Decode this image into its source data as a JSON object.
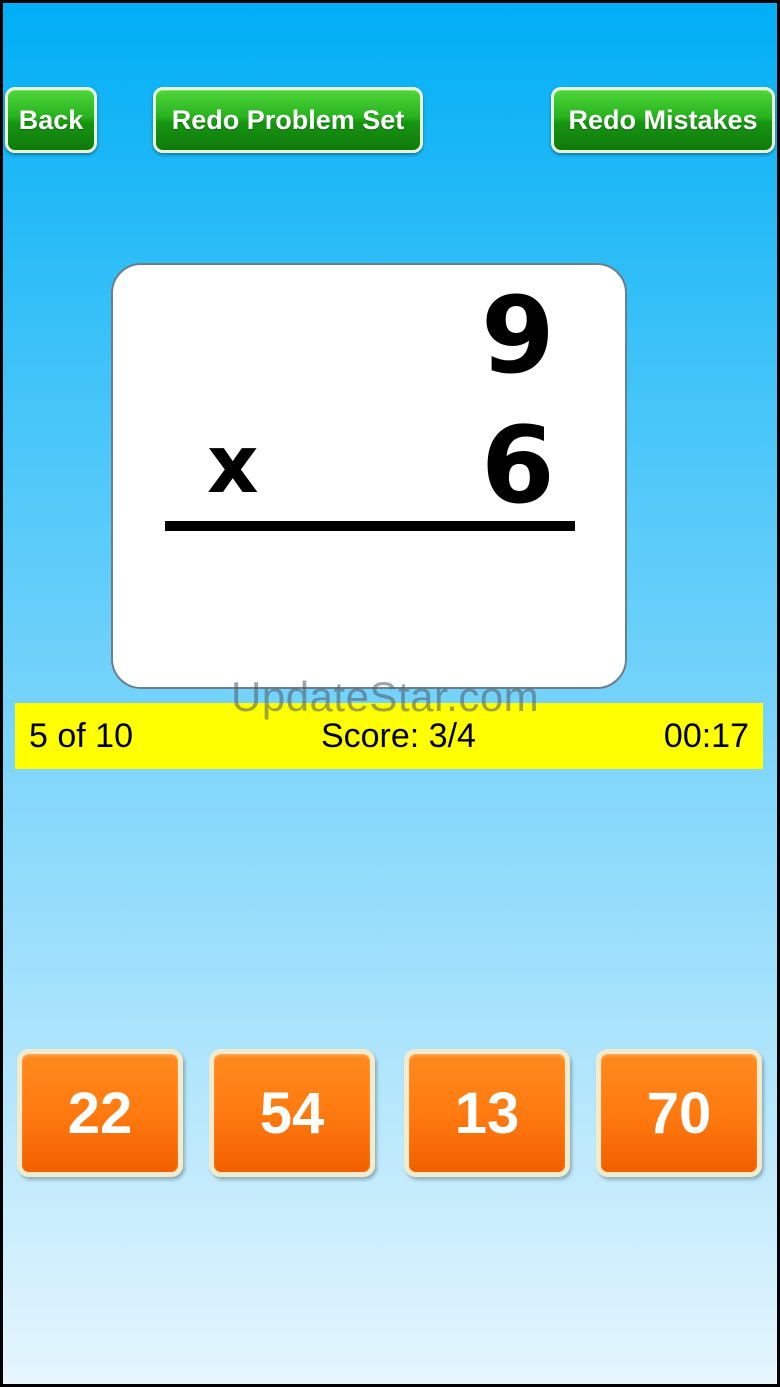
{
  "toolbar": {
    "back_label": "Back",
    "redo_set_label": "Redo Problem Set",
    "redo_mistakes_label": "Redo Mistakes"
  },
  "problem": {
    "top_number": "9",
    "operator": "x",
    "bottom_number": "6"
  },
  "status": {
    "progress": "5 of 10",
    "score": "Score: 3/4",
    "timer": "00:17"
  },
  "watermark": "UpdateStar.com",
  "answers": [
    "22",
    "54",
    "13",
    "70"
  ],
  "colors": {
    "button_green": "#169411",
    "answer_orange": "#ff7a10",
    "status_yellow": "#ffff00",
    "sky_top": "#00aef5"
  }
}
